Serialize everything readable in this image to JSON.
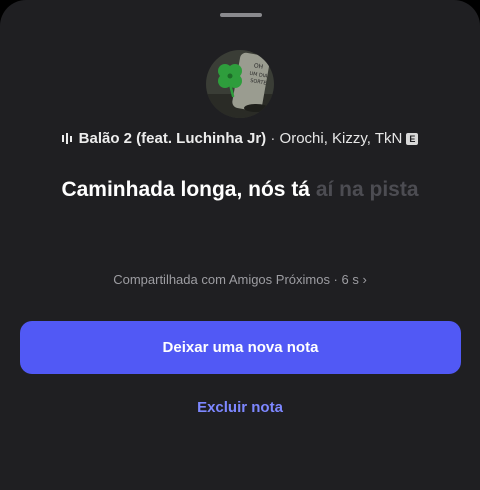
{
  "song": {
    "title": "Balão 2 (feat. Luchinha Jr)",
    "separator": " · ",
    "artists": "Orochi, Kizzy, TkN",
    "explicit_badge": "E"
  },
  "lyrics": {
    "sung": "Caminhada longa, nós tá",
    "upcoming": " aí na pista"
  },
  "share_info": "Compartilhada com Amigos Próximos · 6 s ›",
  "actions": {
    "new_note_label": "Deixar uma nova nota",
    "delete_note_label": "Excluir nota"
  },
  "icons": {
    "playing": "sound-bars-icon",
    "cover": "album-cover-clover-icon"
  },
  "colors": {
    "background": "#1f1f22",
    "primary_button": "#5159f5",
    "link": "#7d87ff",
    "upcoming_lyrics": "#4c4c52"
  }
}
